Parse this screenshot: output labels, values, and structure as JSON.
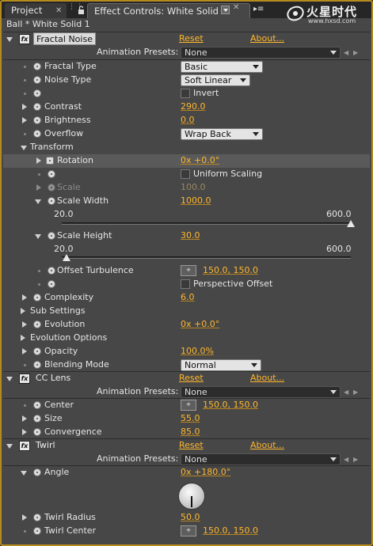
{
  "tabs": {
    "project": "Project",
    "effect_controls": "Effect Controls: White Solid 1"
  },
  "watermark": {
    "title": "火星时代",
    "url": "www.hxsd.com"
  },
  "breadcrumb": "Ball * White Solid 1",
  "common": {
    "reset": "Reset",
    "about": "About...",
    "presets_label": "Animation Presets:",
    "presets_value": "None"
  },
  "fractal_noise": {
    "name": "Fractal Noise",
    "fractal_type": {
      "label": "Fractal Type",
      "value": "Basic"
    },
    "noise_type": {
      "label": "Noise Type",
      "value": "Soft Linear"
    },
    "invert": {
      "label": "Invert"
    },
    "contrast": {
      "label": "Contrast",
      "value": "290.0"
    },
    "brightness": {
      "label": "Brightness",
      "value": "0.0"
    },
    "overflow": {
      "label": "Overflow",
      "value": "Wrap Back"
    },
    "transform": {
      "label": "Transform",
      "rotation": {
        "label": "Rotation",
        "value": "0x +0.0°"
      },
      "uniform_scaling": {
        "label": "Uniform Scaling"
      },
      "scale": {
        "label": "Scale",
        "value": "100.0"
      },
      "scale_width": {
        "label": "Scale Width",
        "value": "1000.0",
        "min": "20.0",
        "max": "600.0",
        "slider_fraction": 1.0
      },
      "scale_height": {
        "label": "Scale Height",
        "value": "30.0",
        "min": "20.0",
        "max": "600.0",
        "slider_fraction": 0.017
      },
      "offset_turbulence": {
        "label": "Offset Turbulence",
        "value": "150.0, 150.0"
      },
      "perspective_offset": {
        "label": "Perspective Offset"
      }
    },
    "complexity": {
      "label": "Complexity",
      "value": "6.0"
    },
    "sub_settings": {
      "label": "Sub Settings"
    },
    "evolution": {
      "label": "Evolution",
      "value": "0x +0.0°"
    },
    "evolution_options": {
      "label": "Evolution Options"
    },
    "opacity": {
      "label": "Opacity",
      "value": "100.0%"
    },
    "blending_mode": {
      "label": "Blending Mode",
      "value": "Normal"
    }
  },
  "cc_lens": {
    "name": "CC Lens",
    "center": {
      "label": "Center",
      "value": "150.0, 150.0"
    },
    "size": {
      "label": "Size",
      "value": "55.0"
    },
    "convergence": {
      "label": "Convergence",
      "value": "85.0"
    }
  },
  "twirl": {
    "name": "Twirl",
    "angle": {
      "label": "Angle",
      "value": "0x +180.0°"
    },
    "twirl_radius": {
      "label": "Twirl Radius",
      "value": "50.0"
    },
    "twirl_center": {
      "label": "Twirl Center",
      "value": "150.0, 150.0"
    }
  },
  "colors": {
    "accent": "#ffb72c",
    "panel": "#474747",
    "frame": "#b48b1c"
  }
}
